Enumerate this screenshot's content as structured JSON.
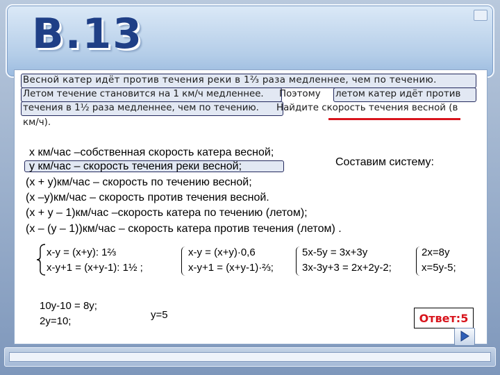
{
  "header": {
    "title": "В.13"
  },
  "problem": {
    "line1": "Весной катер идёт против течения реки в 1⅔ раза медленнее, чем по течению.",
    "line2a": "Летом течение становится на 1 км/ч медленнее.",
    "line2b": " Поэтому ",
    "line2c": "летом катер идёт против",
    "line3a": "течения в 1½ раза медленнее, чем по течению.",
    "line3b": " Найдите скорость течения весной (в",
    "line4": "км/ч)."
  },
  "definitions": {
    "d1": "x км/час –собственная скорость катера весной;",
    "d2": "y км/час – скорость течения реки весной;",
    "d3": "(x + y)км/час – скорость по течению весной;",
    "d4": "(x –y)км/час – скорость против течения весной.",
    "d5": "(x + y – 1)км/час –скорость катера по течению (летом);",
    "d6": "(x – (y – 1))км/час – скорость катера против течения (летом) ."
  },
  "system_label": "Составим систему:",
  "systems": {
    "s1a": "x-y = (x+y): 1⅔",
    "s1b": "x-y+1 = (x+y-1): 1½ ;",
    "s2a": "x-y = (x+y)·0,6",
    "s2b": "x-y+1 = (x+y-1)·⅔;",
    "s3a": "5x-5y = 3x+3y",
    "s3b": "3x-3y+3 = 2x+2y-2;",
    "s4a": "2x=8y",
    "s4b": "x=5y-5;"
  },
  "solution": {
    "l1": "10y-10 = 8y;",
    "l2": "2y=10;",
    "result": "y=5"
  },
  "answer": "Ответ:5",
  "colors": {
    "title": "#1f3f86",
    "highlight_border": "#22285c",
    "underline": "#d8141c",
    "answer": "#d8141c"
  }
}
